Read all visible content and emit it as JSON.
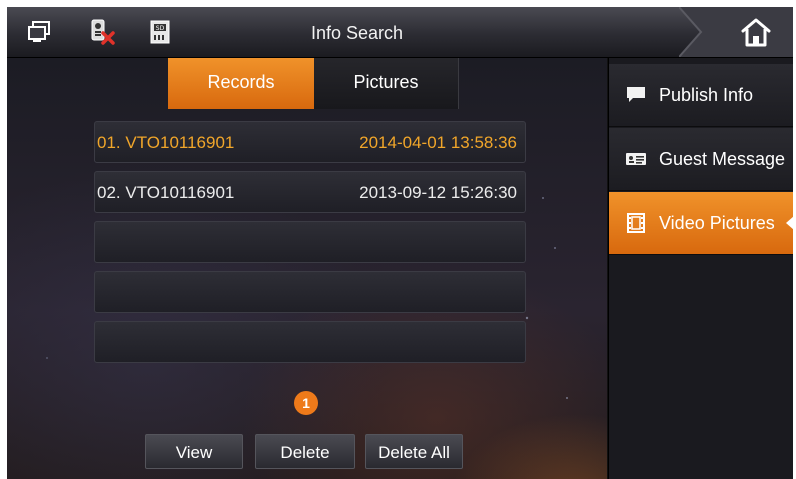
{
  "header": {
    "title": "Info Search",
    "icons": [
      "monitor-icon",
      "doorbell-muted-icon",
      "sd-card-icon",
      "home-icon"
    ]
  },
  "tabs": [
    {
      "label": "Records",
      "active": true
    },
    {
      "label": "Pictures",
      "active": false
    }
  ],
  "records": [
    {
      "num": "01. VTO10116901",
      "time": "2014-04-01 13:58:36",
      "selected": true
    },
    {
      "num": "02. VTO10116901",
      "time": "2013-09-12 15:26:30",
      "selected": false
    },
    {
      "num": "",
      "time": ""
    },
    {
      "num": "",
      "time": ""
    },
    {
      "num": "",
      "time": ""
    }
  ],
  "pagination": {
    "current_page": "1"
  },
  "buttons": {
    "view": "View",
    "delete": "Delete",
    "delete_all": "Delete All"
  },
  "sidebar": {
    "items": [
      {
        "label": "Publish Info",
        "icon": "chat-bubble-icon",
        "active": false
      },
      {
        "label": "Guest Message",
        "icon": "message-card-icon",
        "active": false
      },
      {
        "label": "Video Pictures",
        "icon": "film-icon",
        "active": true
      }
    ]
  },
  "colors": {
    "accent": "#e8801c",
    "selected_text": "#f1a62a"
  }
}
